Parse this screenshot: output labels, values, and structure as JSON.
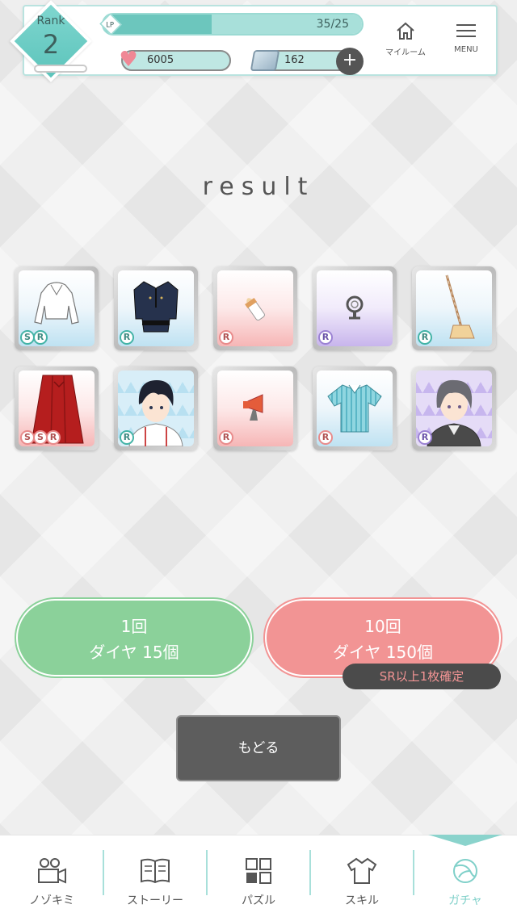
{
  "header": {
    "rank_label": "Rank",
    "rank_value": "2",
    "lp_label": "LP",
    "lp_value": "35/25",
    "hearts": "6005",
    "diamonds": "162",
    "plus": "+",
    "myroom_label": "マイルーム",
    "menu_label": "MENU"
  },
  "result_title": "result",
  "items": [
    {
      "name": "white-crop-top",
      "bg": "blue",
      "rarity": [
        "S",
        "R"
      ],
      "rarity_color": "teal"
    },
    {
      "name": "police-uniform",
      "bg": "blue",
      "rarity": [
        "R"
      ],
      "rarity_color": "teal"
    },
    {
      "name": "baby-bottle",
      "bg": "pink",
      "rarity": [
        "R"
      ],
      "rarity_color": "pink"
    },
    {
      "name": "ring-accessory",
      "bg": "purple",
      "rarity": [
        "R"
      ],
      "rarity_color": "purple"
    },
    {
      "name": "mop",
      "bg": "blue",
      "rarity": [
        "R"
      ],
      "rarity_color": "teal"
    },
    {
      "name": "red-skirt",
      "bg": "pink",
      "rarity": [
        "S",
        "S",
        "R"
      ],
      "rarity_color": "pink"
    },
    {
      "name": "dark-haired-character",
      "bg": "tri-blue",
      "rarity": [
        "R"
      ],
      "rarity_color": "teal"
    },
    {
      "name": "megaphone",
      "bg": "pink",
      "rarity": [
        "R"
      ],
      "rarity_color": "pink"
    },
    {
      "name": "striped-shirt",
      "bg": "blue",
      "rarity": [
        "R"
      ],
      "rarity_color": "pink"
    },
    {
      "name": "gray-haired-character",
      "bg": "tri-purple",
      "rarity": [
        "R"
      ],
      "rarity_color": "purple"
    }
  ],
  "gacha": {
    "single_line1": "1回",
    "single_line2": "ダイヤ 15個",
    "ten_line1": "10回",
    "ten_line2": "ダイヤ 150個",
    "guarantee": "SR以上1枚確定"
  },
  "back_label": "もどる",
  "nav": [
    {
      "label": "ノゾキミ",
      "icon": "camera-icon"
    },
    {
      "label": "ストーリー",
      "icon": "book-icon"
    },
    {
      "label": "パズル",
      "icon": "puzzle-icon"
    },
    {
      "label": "スキル",
      "icon": "shirt-icon"
    },
    {
      "label": "ガチャ",
      "icon": "gacha-ball-icon",
      "active": true
    }
  ],
  "colors": {
    "accent": "#7fd0c9",
    "single_button": "#8bd19a",
    "ten_button": "#f29494",
    "back_button": "#5d5d5d"
  }
}
